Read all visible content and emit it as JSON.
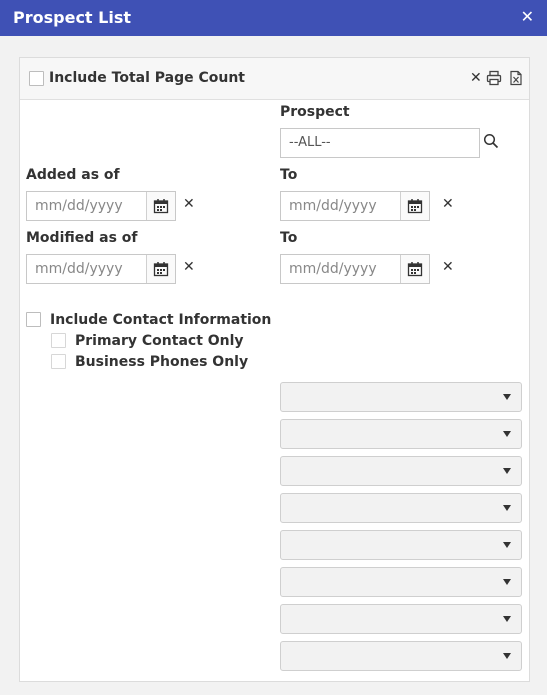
{
  "window": {
    "title": "Prospect List",
    "close_symbol": "✕"
  },
  "header": {
    "include_total_page_count_label": "Include Total Page Count",
    "include_total_page_count_checked": false,
    "icons": [
      "clear-icon",
      "print-icon",
      "excel-export-icon"
    ],
    "clear_symbol": "✕"
  },
  "form": {
    "prospect": {
      "label": "Prospect",
      "value": "--ALL--"
    },
    "added": {
      "label": "Added as of",
      "from_placeholder": "mm/dd/yyyy",
      "to_label": "To",
      "to_placeholder": "mm/dd/yyyy"
    },
    "modified": {
      "label": "Modified as of",
      "from_placeholder": "mm/dd/yyyy",
      "to_label": "To",
      "to_placeholder": "mm/dd/yyyy"
    },
    "clear_symbol": "✕",
    "include_contact_information": {
      "label": "Include Contact Information",
      "checked": false
    },
    "primary_contact_only": {
      "label": "Primary Contact Only",
      "checked": false
    },
    "business_phones_only": {
      "label": "Business Phones Only",
      "checked": false
    },
    "dropdowns": [
      "",
      "",
      "",
      "",
      "",
      "",
      "",
      ""
    ]
  }
}
